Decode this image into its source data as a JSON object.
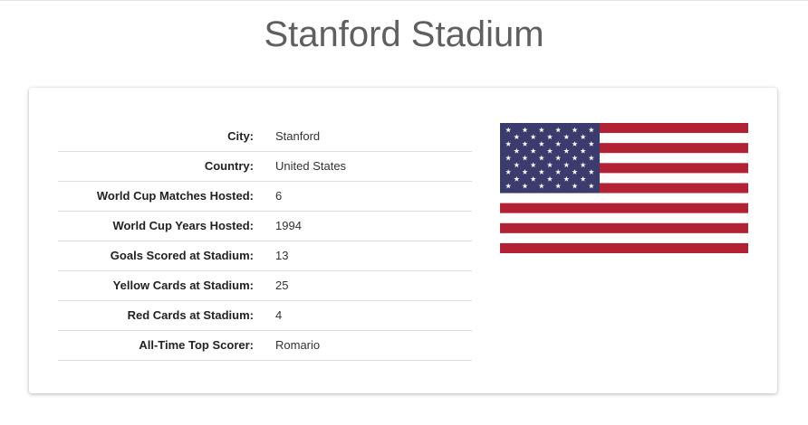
{
  "page": {
    "title": "Stanford Stadium"
  },
  "stadium_info": {
    "rows": [
      {
        "label": "City:",
        "value": "Stanford"
      },
      {
        "label": "Country:",
        "value": "United States"
      },
      {
        "label": "World Cup Matches Hosted:",
        "value": "6"
      },
      {
        "label": "World Cup Years Hosted:",
        "value": "1994"
      },
      {
        "label": "Goals Scored at Stadium:",
        "value": "13"
      },
      {
        "label": "Yellow Cards at Stadium:",
        "value": "25"
      },
      {
        "label": "Red Cards at Stadium:",
        "value": "4"
      },
      {
        "label": "All-Time Top Scorer:",
        "value": "Romario"
      }
    ]
  },
  "flag": {
    "icon": "united-states-flag-icon",
    "colors": {
      "red": "#B22234",
      "white": "#FFFFFF",
      "blue": "#3C3B6E"
    }
  }
}
